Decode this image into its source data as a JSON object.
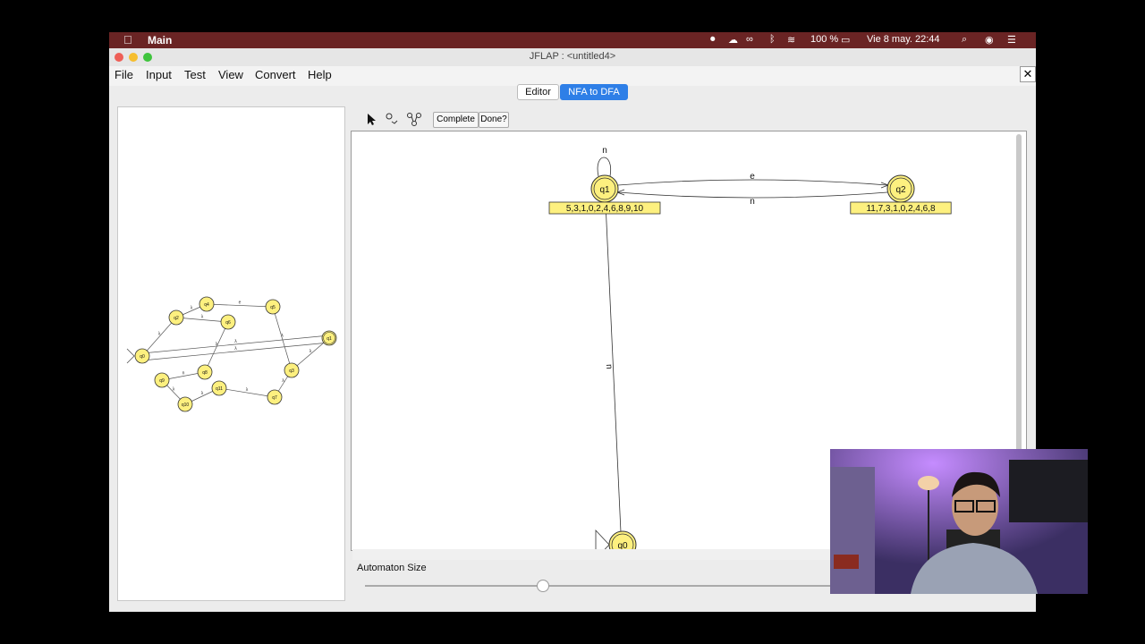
{
  "system_bar": {
    "app_name": "Main",
    "battery": "100 %",
    "datetime": "Vie 8 may.  22:44"
  },
  "window": {
    "title": "JFLAP : <untitled4>",
    "close_label": "✕"
  },
  "menus": [
    "File",
    "Input",
    "Test",
    "View",
    "Convert",
    "Help"
  ],
  "tabs": {
    "editor": "Editor",
    "nfa_to_dfa": "NFA to DFA",
    "active": "NFA to DFA"
  },
  "toolbar": {
    "tools": [
      "attribute-editor-icon",
      "state-expander-icon",
      "transition-expander-icon"
    ],
    "complete_label": "Complete",
    "done_label": "Done?"
  },
  "nfa": {
    "states": [
      "q0",
      "q1",
      "q2",
      "q3",
      "q4",
      "q5",
      "q6",
      "q7",
      "q8",
      "q9",
      "q10",
      "q11"
    ],
    "edges": [
      {
        "from": "q0",
        "to": "q2",
        "label": "λ"
      },
      {
        "from": "q2",
        "to": "q4",
        "label": "λ"
      },
      {
        "from": "q2",
        "to": "q6",
        "label": "λ"
      },
      {
        "from": "q4",
        "to": "q5",
        "label": "e"
      },
      {
        "from": "q6",
        "to": "q8",
        "label": "λ"
      },
      {
        "from": "q5",
        "to": "q3",
        "label": "λ"
      },
      {
        "from": "q3",
        "to": "q1",
        "label": "λ"
      },
      {
        "from": "q0",
        "to": "q1",
        "label": "λ"
      },
      {
        "from": "q1",
        "to": "q0",
        "label": "λ"
      },
      {
        "from": "q8",
        "to": "q9",
        "label": "n"
      },
      {
        "from": "q9",
        "to": "q10",
        "label": "λ"
      },
      {
        "from": "q10",
        "to": "q11",
        "label": "λ"
      },
      {
        "from": "q11",
        "to": "q7",
        "label": "λ"
      },
      {
        "from": "q7",
        "to": "q3",
        "label": "λ"
      }
    ]
  },
  "dfa": {
    "states": [
      {
        "name": "q1",
        "label": "5,3,1,0,2,4,6,8,9,10",
        "final": true
      },
      {
        "name": "q2",
        "label": "11,7,3,1,0,2,4,6,8",
        "final": true
      },
      {
        "name": "q0",
        "label": "",
        "final": true,
        "initial": true
      }
    ],
    "edges": [
      {
        "from": "q1",
        "to": "q1",
        "label": "n"
      },
      {
        "from": "q1",
        "to": "q2",
        "label": "e"
      },
      {
        "from": "q2",
        "to": "q1",
        "label": "n"
      },
      {
        "from": "q0",
        "to": "q1",
        "label": "n"
      }
    ]
  },
  "automaton_size": {
    "label": "Automaton Size",
    "value": 0.38
  },
  "colors": {
    "state_fill": "#fdf07f",
    "state_stroke": "#333333",
    "tab_active": "#2e7fe7",
    "menubar": "#6a2424"
  }
}
